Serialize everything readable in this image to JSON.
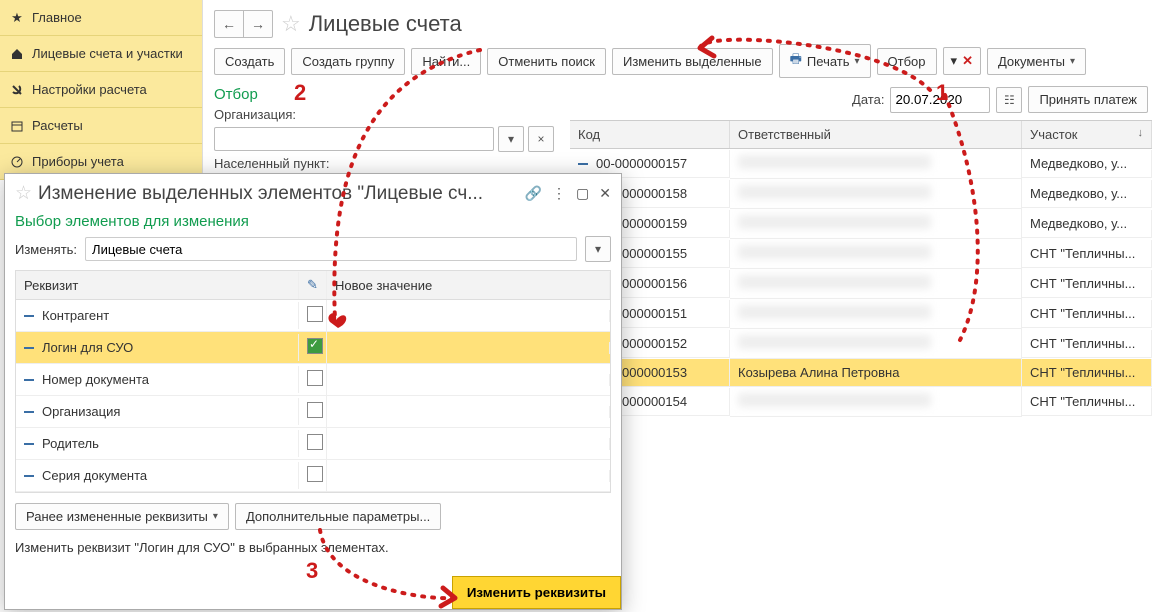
{
  "sidebar": {
    "items": [
      {
        "label": "Главное",
        "icon": "star-icon"
      },
      {
        "label": "Лицевые счета и участки",
        "icon": "house-icon"
      },
      {
        "label": "Настройки расчета",
        "icon": "wrench-icon"
      },
      {
        "label": "Расчеты",
        "icon": "calendar-icon"
      },
      {
        "label": "Приборы учета",
        "icon": "meter-icon"
      }
    ]
  },
  "header": {
    "title": "Лицевые счета"
  },
  "toolbar": {
    "create": "Создать",
    "create_group": "Создать группу",
    "find": "Найти...",
    "cancel_search": "Отменить поиск",
    "change_selected": "Изменить выделенные",
    "print": "Печать",
    "filter": "Отбор",
    "documents": "Документы"
  },
  "filter": {
    "title": "Отбор",
    "org_label": "Организация:",
    "town_label": "Населенный пункт:",
    "date_label": "Дата:",
    "date_value": "20.07.2020",
    "accept_payment": "Принять платеж"
  },
  "grid": {
    "columns": {
      "code": "Код",
      "responsible": "Ответственный",
      "area": "Участок"
    },
    "sort_col": "area",
    "rows": [
      {
        "code": "00-0000000157",
        "responsible": "",
        "area": "Медведково, у..."
      },
      {
        "code": "00-0000000158",
        "responsible": "",
        "area": "Медведково, у..."
      },
      {
        "code": "00-0000000159",
        "responsible": "",
        "area": "Медведково, у..."
      },
      {
        "code": "00-0000000155",
        "responsible": "",
        "area": "СНТ \"Тепличны..."
      },
      {
        "code": "00-0000000156",
        "responsible": "",
        "area": "СНТ \"Тепличны..."
      },
      {
        "code": "00-0000000151",
        "responsible": "",
        "area": "СНТ \"Тепличны..."
      },
      {
        "code": "00-0000000152",
        "responsible": "",
        "area": "СНТ \"Тепличны..."
      },
      {
        "code": "00-0000000153",
        "responsible": "Козырева Алина Петровна",
        "area": "СНТ \"Тепличны...",
        "selected": true
      },
      {
        "code": "00-0000000154",
        "responsible": "",
        "area": "СНТ \"Тепличны..."
      }
    ]
  },
  "modal": {
    "title": "Изменение выделенных элементов \"Лицевые сч...",
    "subtitle": "Выбор элементов для изменения",
    "change_label": "Изменять:",
    "change_value": "Лицевые счета",
    "columns": {
      "req": "Реквизит",
      "new_val": "Новое значение"
    },
    "rows": [
      {
        "name": "Контрагент",
        "checked": false
      },
      {
        "name": "Логин для СУО",
        "checked": true,
        "selected": true
      },
      {
        "name": "Номер документа",
        "checked": false
      },
      {
        "name": "Организация",
        "checked": false
      },
      {
        "name": "Родитель",
        "checked": false
      },
      {
        "name": "Серия документа",
        "checked": false
      }
    ],
    "prev_changed_btn": "Ранее измененные реквизиты",
    "extra_params_btn": "Дополнительные параметры...",
    "hint": "Изменить реквизит \"Логин для СУО\" в выбранных элементах.",
    "commit_btn": "Изменить реквизиты"
  },
  "annotations": {
    "n1": "1",
    "n2": "2",
    "n3": "3"
  },
  "colors": {
    "sidebar_bg": "#fbe99d",
    "accent_green": "#119c4f",
    "highlight": "#ffe17a",
    "anno_red": "#cc1b1b"
  }
}
